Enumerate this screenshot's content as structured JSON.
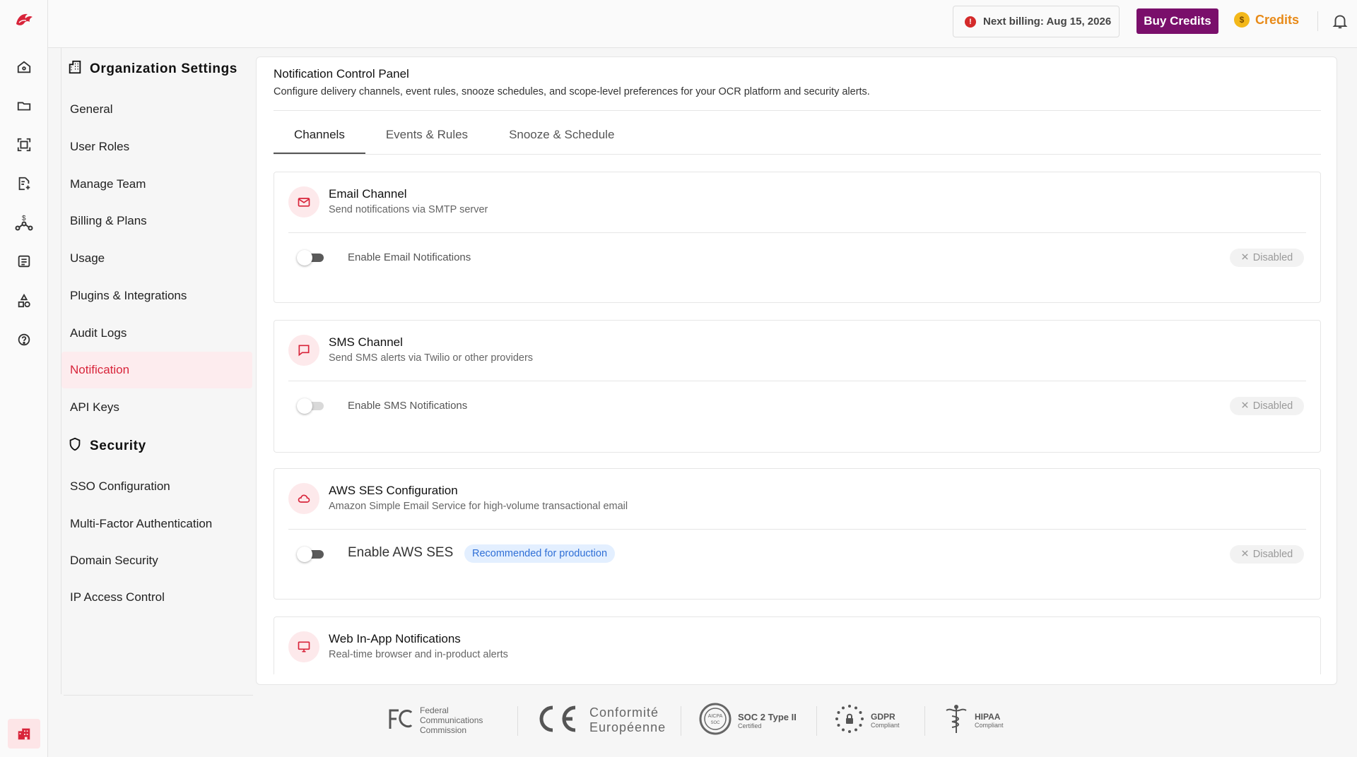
{
  "topbar": {
    "billing_text": "Next billing: Aug 15, 2026",
    "buy_label": "Buy Credits",
    "credits_label": "Credits"
  },
  "settings": {
    "org_heading": "Organization Settings",
    "org_items": [
      "General",
      "User Roles",
      "Manage Team",
      "Billing & Plans",
      "Usage",
      "Plugins & Integrations",
      "Audit Logs",
      "Notification",
      "API Keys"
    ],
    "active_item": "Notification",
    "security_heading": "Security",
    "security_items": [
      "SSO Configuration",
      "Multi-Factor Authentication",
      "Domain Security",
      "IP Access Control"
    ]
  },
  "panel": {
    "title": "Notification Control Panel",
    "subtitle": "Configure delivery channels, event rules, snooze schedules, and scope-level preferences for your OCR platform and security alerts.",
    "tabs": [
      "Channels",
      "Events & Rules",
      "Snooze & Schedule"
    ],
    "active_tab": "Channels"
  },
  "cards": [
    {
      "title": "Email Channel",
      "subtitle": "Send notifications via SMTP server",
      "toggle_label": "Enable Email Notifications",
      "status": "Disabled",
      "icon": "mail-icon"
    },
    {
      "title": "SMS Channel",
      "subtitle": "Send SMS alerts via Twilio or other providers",
      "toggle_label": "Enable SMS Notifications",
      "status": "Disabled",
      "icon": "message-icon"
    },
    {
      "title": "AWS SES Configuration",
      "subtitle": "Amazon Simple Email Service for high-volume transactional email",
      "toggle_label": "Enable AWS SES",
      "badge": "Recommended for production",
      "status": "Disabled",
      "icon": "cloud-icon"
    },
    {
      "title": "Web In-App Notifications",
      "subtitle": "Real-time browser and in-product alerts",
      "icon": "monitor-icon"
    }
  ],
  "footer": {
    "fcc": [
      "Federal",
      "Communications",
      "Commission"
    ],
    "ce": [
      "Conformité",
      "Européenne"
    ],
    "soc_title": "SOC 2 Type II",
    "soc_sub": "Certified",
    "soc_seal": [
      "AICPA",
      "SOC"
    ],
    "gdpr_title": "GDPR",
    "gdpr_sub": "Compliant",
    "hipaa_title": "HIPAA",
    "hipaa_sub": "Compliant"
  },
  "colors": {
    "accent": "#d8243a",
    "buy_button": "#7a0f6b",
    "credits": "#e88a18",
    "info_badge_bg": "#e3efff",
    "info_badge_text": "#2f6fd6"
  }
}
